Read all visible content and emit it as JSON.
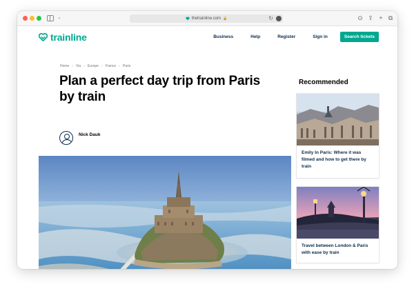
{
  "browser": {
    "url": "thetrainline.com"
  },
  "header": {
    "logo": "trainline",
    "nav": [
      "Business",
      "Help",
      "Register",
      "Sign in"
    ],
    "cta": "Search tickets"
  },
  "article": {
    "breadcrumb": [
      "Home",
      "Via",
      "Europe",
      "France",
      "Paris"
    ],
    "title": "Plan a perfect day trip from Paris by train",
    "author": "Nick Dauk"
  },
  "recommended": {
    "heading": "Recommended",
    "cards": [
      {
        "title": "Emily In Paris: Where it was filmed and how to get there by train"
      },
      {
        "title": "Travel between London & Paris with ease by train"
      }
    ]
  },
  "colors": {
    "brand": "#00a88f",
    "navText": "#0b2a4a"
  }
}
